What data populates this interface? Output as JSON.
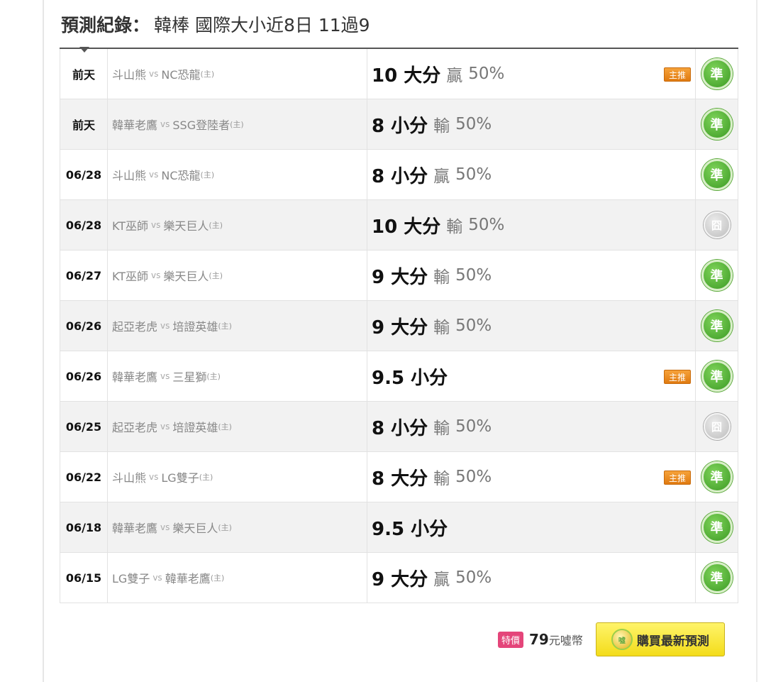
{
  "header": {
    "label": "預測紀錄",
    "colon": "：",
    "subtitle": "韓棒 國際大小近8日 11過9"
  },
  "labels": {
    "vs": "vs",
    "home_marker": "(主)",
    "main_pick_badge": "主推"
  },
  "status_icons": {
    "win": "準",
    "miss": "囧"
  },
  "records": [
    {
      "date": "前天",
      "away": "斗山熊",
      "home": "NC恐龍",
      "pick": "10 大分",
      "result": "贏",
      "pct": "50%",
      "main_pick": true,
      "status": "win"
    },
    {
      "date": "前天",
      "away": "韓華老鷹",
      "home": "SSG登陸者",
      "pick": "8 小分",
      "result": "輸",
      "pct": "50%",
      "main_pick": false,
      "status": "win"
    },
    {
      "date": "06/28",
      "away": "斗山熊",
      "home": "NC恐龍",
      "pick": "8 小分",
      "result": "贏",
      "pct": "50%",
      "main_pick": false,
      "status": "win"
    },
    {
      "date": "06/28",
      "away": "KT巫師",
      "home": "樂天巨人",
      "pick": "10 大分",
      "result": "輸",
      "pct": "50%",
      "main_pick": false,
      "status": "miss"
    },
    {
      "date": "06/27",
      "away": "KT巫師",
      "home": "樂天巨人",
      "pick": "9 大分",
      "result": "輸",
      "pct": "50%",
      "main_pick": false,
      "status": "win"
    },
    {
      "date": "06/26",
      "away": "起亞老虎",
      "home": "培證英雄",
      "pick": "9 大分",
      "result": "輸",
      "pct": "50%",
      "main_pick": false,
      "status": "win"
    },
    {
      "date": "06/26",
      "away": "韓華老鷹",
      "home": "三星獅",
      "pick": "9.5 小分",
      "result": "",
      "pct": "",
      "main_pick": true,
      "status": "win"
    },
    {
      "date": "06/25",
      "away": "起亞老虎",
      "home": "培證英雄",
      "pick": "8 小分",
      "result": "輸",
      "pct": "50%",
      "main_pick": false,
      "status": "miss"
    },
    {
      "date": "06/22",
      "away": "斗山熊",
      "home": "LG雙子",
      "pick": "8 大分",
      "result": "輸",
      "pct": "50%",
      "main_pick": true,
      "status": "win"
    },
    {
      "date": "06/18",
      "away": "韓華老鷹",
      "home": "樂天巨人",
      "pick": "9.5 小分",
      "result": "",
      "pct": "",
      "main_pick": false,
      "status": "win"
    },
    {
      "date": "06/15",
      "away": "LG雙子",
      "home": "韓華老鷹",
      "pick": "9 大分",
      "result": "贏",
      "pct": "50%",
      "main_pick": false,
      "status": "win"
    }
  ],
  "footer": {
    "special_label": "特價",
    "price": "79",
    "price_unit": "元噓幣",
    "buy_label": "購買最新預測",
    "coin_icon_text": "噓"
  }
}
